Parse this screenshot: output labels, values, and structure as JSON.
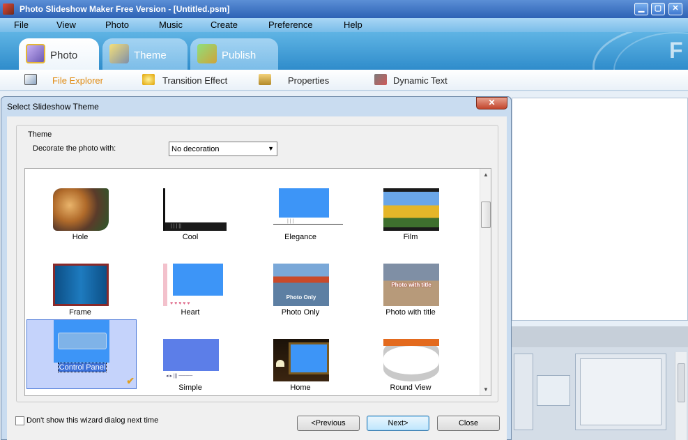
{
  "window": {
    "title": "Photo Slideshow Maker Free Version - [Untitled.psm]",
    "minimize": "▁",
    "maximize": "▢",
    "close": "✕"
  },
  "menu": [
    "File",
    "View",
    "Photo",
    "Music",
    "Create",
    "Preference",
    "Help"
  ],
  "tabs": [
    {
      "label": "Photo",
      "icon": "photo-icon",
      "active": true
    },
    {
      "label": "Theme",
      "icon": "theme-icon",
      "active": false
    },
    {
      "label": "Publish",
      "icon": "publish-icon",
      "active": false
    }
  ],
  "subtabs": [
    {
      "label": "File Explorer",
      "icon": "file-explorer-icon",
      "active": true
    },
    {
      "label": "Transition Effect",
      "icon": "transition-effect-icon"
    },
    {
      "label": "Properties",
      "icon": "properties-icon"
    },
    {
      "label": "Dynamic Text",
      "icon": "dynamic-text-icon"
    }
  ],
  "colors": {
    "accent": "#2f8ccb",
    "active_subtab": "#e08a10",
    "selection": "#3a6fd8"
  },
  "dialog": {
    "title": "Select Slideshow Theme",
    "close": "✕",
    "group_label": "Theme",
    "decorate_label": "Decorate the photo with:",
    "decoration_value": "No decoration",
    "themes": [
      {
        "name": "Hole"
      },
      {
        "name": "Cool"
      },
      {
        "name": "Elegance"
      },
      {
        "name": "Film"
      },
      {
        "name": "Frame"
      },
      {
        "name": "Heart"
      },
      {
        "name": "Photo Only",
        "overlay": "Photo Only"
      },
      {
        "name": "Photo with title",
        "overlay": "Photo with title"
      },
      {
        "name": "Control Panel",
        "selected": true
      },
      {
        "name": "Simple"
      },
      {
        "name": "Home"
      },
      {
        "name": "Round View"
      }
    ],
    "dont_show_label": "Don't show this wizard dialog next time",
    "dont_show_checked": false,
    "buttons": {
      "previous": "<Previous",
      "next": "Next>",
      "close": "Close"
    }
  }
}
